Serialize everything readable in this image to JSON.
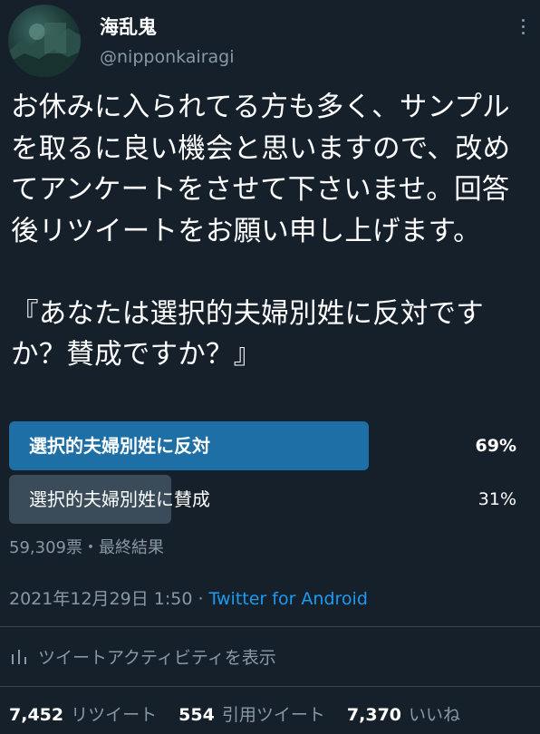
{
  "author": {
    "display_name": "海乱鬼",
    "handle": "@nipponkairagi"
  },
  "tweet": {
    "text": "お休みに入られてる方も多く、サンプルを取るに良い機会と思いますので、改めてアンケートをさせて下さいませ。回答後リツイートをお願い申し上げます。\n\n『あなたは選択的夫婦別姓に反対ですか？賛成ですか？』"
  },
  "poll": {
    "options": [
      {
        "label": "選択的夫婦別姓に反対",
        "percent_label": "69%",
        "share": 0.69,
        "winner": true
      },
      {
        "label": "選択的夫婦別姓に賛成",
        "percent_label": "31%",
        "share": 0.31,
        "winner": false
      }
    ],
    "meta": "59,309票・最終結果",
    "colors": {
      "winner_bar": "#1d6fa5",
      "other_bar": "#3a4b5a"
    }
  },
  "timestamp": {
    "datetime": "2021年12月29日 1:50 · ",
    "source": "Twitter for Android"
  },
  "activity": {
    "label": "ツイートアクティビティを表示",
    "icon": "bar-chart-icon"
  },
  "stats": {
    "retweets": {
      "count": "7,452",
      "label": "リツイート"
    },
    "quotes": {
      "count": "554",
      "label": "引用ツイート"
    },
    "likes": {
      "count": "7,370",
      "label": "いいね"
    }
  },
  "theme": {
    "background": "#15202b",
    "text": "#ffffff",
    "secondary": "#8899a6",
    "link": "#1d9bf0",
    "divider": "#38444d"
  }
}
